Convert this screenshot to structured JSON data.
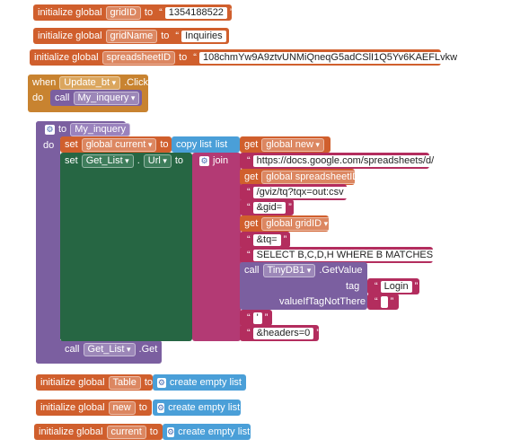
{
  "globals": {
    "init_label": "initialize global",
    "to": "to",
    "gridID_name": "gridID",
    "gridID_value": "1354188522",
    "gridName_name": "gridName",
    "gridName_value": "Inquiries",
    "spreadsheetID_name": "spreadsheetID",
    "spreadsheetID_value": "108chmYw9A9ztvUNMiQneqG5adCSlI1Q5Yv6KAEFLvkw",
    "table_name": "Table",
    "new_name": "new",
    "current_name": "current",
    "empty_list": "create empty list"
  },
  "when": {
    "when": "when",
    "component": "Update_bt",
    "event": ".Click",
    "do": "do",
    "call": "call",
    "proc": "My_inquery"
  },
  "procedure": {
    "to": "to",
    "name": "My_inquery",
    "do": "do",
    "set": "set",
    "global_current": "global current",
    "to2": "to",
    "copy_list": "copy list",
    "list": "list",
    "get": "get",
    "global_new": "global new",
    "set2": "set",
    "component": "Get_List",
    "prop": "Url",
    "to3": "to",
    "join": "join",
    "s1": "https://docs.google.com/spreadsheets/d/",
    "get_spreadsheet": "global spreadsheetID",
    "s2": "/gviz/tq?tqx=out:csv",
    "s3": "&gid=",
    "get_grid": "global gridID",
    "s4": "&tq=",
    "s5": "SELECT B,C,D,H WHERE B MATCHES ",
    "call": "call",
    "tinydb": "TinyDB1",
    "getvalue": ".GetValue",
    "tag": "tag",
    "tag_value": "Login",
    "notthere": "valueIfTagNotThere",
    "notthere_value": " ",
    "s6": "'",
    "s7": "&headers=0",
    "call2": "call",
    "get_list": "Get_List",
    ".get": ".Get"
  }
}
